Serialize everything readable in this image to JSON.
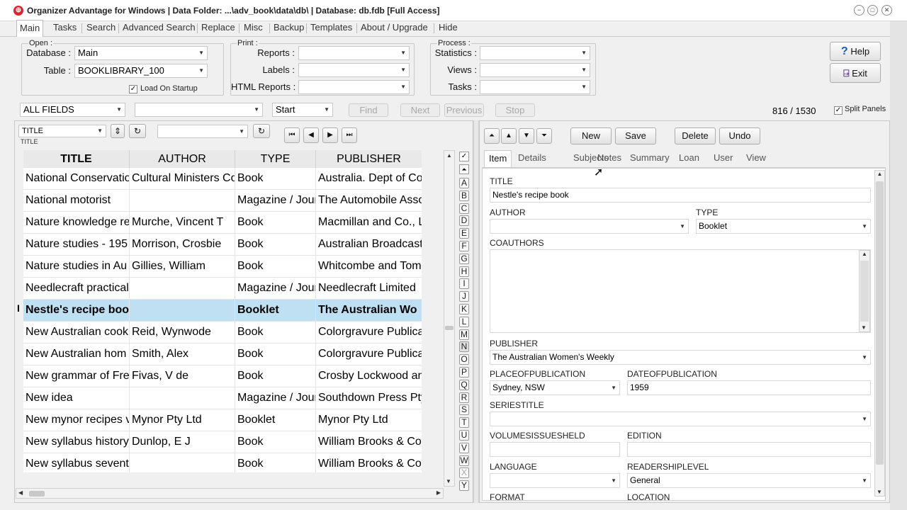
{
  "window": {
    "title": "Organizer Advantage for Windows | Data Folder: ...\\adv_book\\data\\db\\ | Database: db.fdb [Full Access]",
    "app_icon": "app-logo-icon",
    "minimize": "−",
    "maximize": "□",
    "close": "✕"
  },
  "menu_tabs": [
    "Main",
    "Tasks",
    "Search",
    "Advanced Search",
    "Replace",
    "Misc",
    "Backup",
    "Templates",
    "About / Upgrade",
    "Hide"
  ],
  "open_group": {
    "legend": "Open :",
    "database_label": "Database :",
    "database_value": "Main",
    "table_label": "Table :",
    "table_value": "BOOKLIBRARY_100",
    "load_on_startup_label": "Load On Startup",
    "load_on_startup_checked": true
  },
  "print_group": {
    "legend": "Print :",
    "reports_label": "Reports :",
    "labels_label": "Labels :",
    "html_reports_label": "HTML Reports :"
  },
  "process_group": {
    "legend": "Process :",
    "statistics_label": "Statistics :",
    "views_label": "Views :",
    "tasks_label": "Tasks :"
  },
  "help_label": "Help",
  "exit_label": "Exit",
  "search_bar": {
    "field_value": "ALL FIELDS",
    "term_value": "",
    "position_value": "Start",
    "find": "Find",
    "next": "Next",
    "previous": "Previous",
    "stop": "Stop"
  },
  "record_count": "816 / 1530",
  "split_panels_label": "Split Panels",
  "split_panels_checked": true,
  "sort_field": {
    "value": "TITLE",
    "caption": "TITLE"
  },
  "grid": {
    "columns": [
      "TITLE",
      "AUTHOR",
      "TYPE",
      "PUBLISHER"
    ],
    "indicator": "I",
    "rows": [
      [
        "National Conservatio",
        "Cultural Ministers Co",
        "Book",
        "Australia. Dept of Co"
      ],
      [
        "National motorist",
        "",
        "Magazine / Jour",
        "The Automobile Asso"
      ],
      [
        "Nature knowledge re",
        "Murche, Vincent T",
        "Book",
        "Macmillan and Co., L"
      ],
      [
        "Nature studies - 195",
        "Morrison, Crosbie",
        "Book",
        "Australian Broadcasti"
      ],
      [
        "Nature studies in Au",
        "Gillies, William",
        "Book",
        "Whitcombe and Tom"
      ],
      [
        "Needlecraft practical",
        "",
        "Magazine / Jour",
        "Needlecraft Limited"
      ],
      [
        "Nestle's recipe boo",
        "",
        "Booklet",
        "The Australian Wo"
      ],
      [
        "New Australian cook",
        "Reid, Wynwode",
        "Book",
        "Colorgravure Publica"
      ],
      [
        "New Australian hom",
        "Smith, Alex",
        "Book",
        "Colorgravure Publica"
      ],
      [
        "New grammar of Fre",
        "Fivas, V de",
        "Book",
        "Crosby Lockwood an"
      ],
      [
        "New idea",
        "",
        "Magazine / Jour",
        "Southdown Press Pty"
      ],
      [
        "New mynor recipes v",
        "Mynor Pty Ltd",
        "Booklet",
        "Mynor Pty Ltd"
      ],
      [
        "New syllabus history",
        "Dunlop, E J",
        "Book",
        "William Brooks & Co"
      ],
      [
        "New syllabus seventh",
        "",
        "Book",
        "William Brooks & Co"
      ]
    ]
  },
  "alphabet": [
    "A",
    "B",
    "C",
    "D",
    "E",
    "F",
    "G",
    "H",
    "I",
    "J",
    "K",
    "L",
    "M",
    "N",
    "O",
    "P",
    "Q",
    "R",
    "S",
    "T",
    "U",
    "V",
    "W",
    "X",
    "Y"
  ],
  "record_buttons": {
    "new": "New",
    "save": "Save",
    "delete": "Delete",
    "undo": "Undo"
  },
  "record_tabs": [
    "Item",
    "Details",
    "Subjects",
    "Notes",
    "Summary",
    "Loan",
    "User",
    "View"
  ],
  "form": {
    "title_label": "TITLE",
    "title_value": "Nestle's recipe book",
    "author_label": "AUTHOR",
    "author_value": "",
    "type_label": "TYPE",
    "type_value": "Booklet",
    "coauthors_label": "COAUTHORS",
    "coauthors_value": "",
    "publisher_label": "PUBLISHER",
    "publisher_value": "The Australian Women's Weekly",
    "place_label": "PLACEOFPUBLICATION",
    "place_value": "Sydney, NSW",
    "date_label": "DATEOFPUBLICATION",
    "date_value": "1959",
    "series_label": "SERIESTITLE",
    "series_value": "",
    "volumes_label": "VOLUMESISSUESHELD",
    "volumes_value": "",
    "edition_label": "EDITION",
    "edition_value": "",
    "language_label": "LANGUAGE",
    "language_value": "",
    "readership_label": "READERSHIPLEVEL",
    "readership_value": "General",
    "format_label": "FORMAT",
    "location_label": "LOCATION"
  },
  "colors": {
    "selected_row": "#bfe0f3",
    "app_icon": "#d9272e"
  }
}
